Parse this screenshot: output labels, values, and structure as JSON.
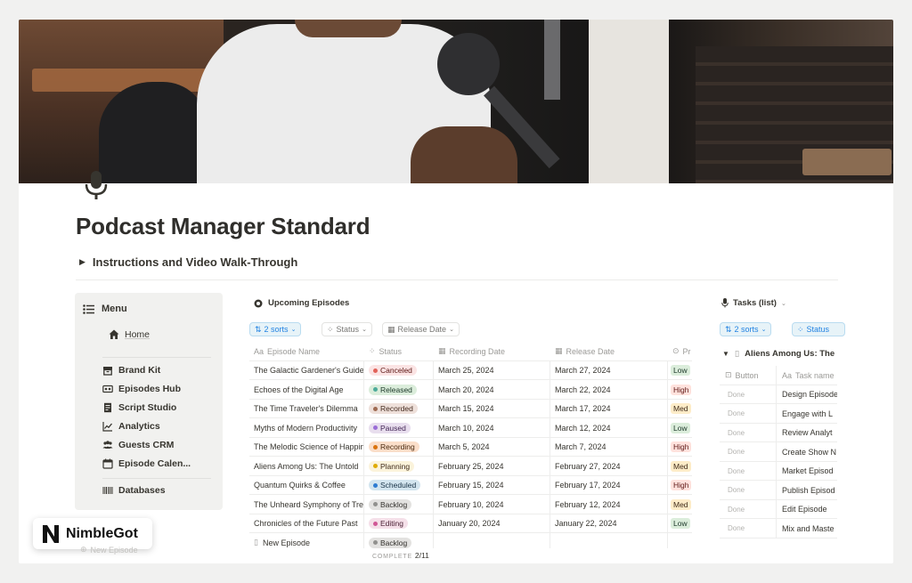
{
  "page": {
    "title": "Podcast Manager Standard",
    "toggle_label": "Instructions and Video Walk-Through"
  },
  "menu": {
    "title": "Menu",
    "home": "Home",
    "items": [
      {
        "label": "Brand Kit",
        "icon": "box-icon"
      },
      {
        "label": "Episodes Hub",
        "icon": "episodes-icon"
      },
      {
        "label": "Script Studio",
        "icon": "document-icon"
      },
      {
        "label": "Analytics",
        "icon": "chart-icon"
      },
      {
        "label": "Guests CRM",
        "icon": "people-icon"
      },
      {
        "label": "Episode Calen...",
        "icon": "calendar-icon"
      }
    ],
    "databases": "Databases"
  },
  "episodes": {
    "title": "Upcoming Episodes",
    "sorts_label": "2 sorts",
    "status_filter": "Status",
    "release_filter": "Release Date",
    "columns": [
      "Episode Name",
      "Status",
      "Recording Date",
      "Release Date",
      "Pr"
    ],
    "rows": [
      {
        "name": "The Galactic Gardener's Guide",
        "status": "Canceled",
        "recording": "March 25, 2024",
        "release": "March 27, 2024",
        "priority": "Low"
      },
      {
        "name": "Echoes of the Digital Age",
        "status": "Released",
        "recording": "March 20, 2024",
        "release": "March 22, 2024",
        "priority": "High"
      },
      {
        "name": "The Time Traveler's Dilemma",
        "status": "Recorded",
        "recording": "March 15, 2024",
        "release": "March 17, 2024",
        "priority": "Med"
      },
      {
        "name": "Myths of Modern Productivity",
        "status": "Paused",
        "recording": "March 10, 2024",
        "release": "March 12, 2024",
        "priority": "Low"
      },
      {
        "name": "The Melodic Science of Happiness",
        "status": "Recording",
        "recording": "March 5, 2024",
        "release": "March 7, 2024",
        "priority": "High"
      },
      {
        "name": "Aliens Among Us: The Untold",
        "status": "Planning",
        "recording": "February 25, 2024",
        "release": "February 27, 2024",
        "priority": "Med"
      },
      {
        "name": "Quantum Quirks & Coffee",
        "status": "Scheduled",
        "recording": "February 15, 2024",
        "release": "February 17, 2024",
        "priority": "High"
      },
      {
        "name": "The Unheard Symphony of Trees",
        "status": "Backlog",
        "recording": "February 10, 2024",
        "release": "February 12, 2024",
        "priority": "Med"
      },
      {
        "name": "Chronicles of the Future Past",
        "status": "Editing",
        "recording": "January 20, 2024",
        "release": "January 22, 2024",
        "priority": "Low"
      },
      {
        "name": "New Episode",
        "status": "Backlog",
        "recording": "",
        "release": "",
        "priority": ""
      }
    ],
    "complete_label": "COMPLETE",
    "complete_value": "2/11"
  },
  "status_colors": {
    "Canceled": {
      "bg": "#fbe4e4",
      "dot": "#e16259",
      "fg": "#5d1715"
    },
    "Released": {
      "bg": "#dbeddb",
      "dot": "#4dab9a",
      "fg": "#1c3829"
    },
    "Recorded": {
      "bg": "#eee0da",
      "dot": "#9f6b53",
      "fg": "#442a1e"
    },
    "Paused": {
      "bg": "#e8deee",
      "dot": "#9a6dd7",
      "fg": "#412454"
    },
    "Recording": {
      "bg": "#fadec9",
      "dot": "#d9730d",
      "fg": "#49290e"
    },
    "Planning": {
      "bg": "#fbf3db",
      "dot": "#dfab01",
      "fg": "#402c1b"
    },
    "Scheduled": {
      "bg": "#d3e5ef",
      "dot": "#2e7cd1",
      "fg": "#183347"
    },
    "Backlog": {
      "bg": "#e3e2e0",
      "dot": "#91918e",
      "fg": "#32302c"
    },
    "Editing": {
      "bg": "#f5e0e9",
      "dot": "#d15796",
      "fg": "#4c2337"
    }
  },
  "priority_colors": {
    "Low": {
      "bg": "#dbeddb",
      "fg": "#1c3829"
    },
    "High": {
      "bg": "#ffe2dd",
      "fg": "#5d1715"
    },
    "Med": {
      "bg": "#fdecc8",
      "fg": "#402c1b"
    }
  },
  "tasks": {
    "title": "Tasks (list)",
    "sorts_label": "2 sorts",
    "status_filter": "Status",
    "group_label": "Aliens Among Us: The",
    "columns": [
      "Button",
      "Task name"
    ],
    "rows": [
      {
        "button": "Done",
        "task": "Design Episode"
      },
      {
        "button": "Done",
        "task": "Engage with L"
      },
      {
        "button": "Done",
        "task": "Review Analyt"
      },
      {
        "button": "Done",
        "task": "Create Show N"
      },
      {
        "button": "Done",
        "task": "Market Episod"
      },
      {
        "button": "Done",
        "task": "Publish Episod"
      },
      {
        "button": "Done",
        "task": "Edit Episode"
      },
      {
        "button": "Done",
        "task": "Mix and Maste"
      }
    ]
  },
  "brand": {
    "name": "NimbleGot",
    "ghost_label": "New Episode"
  }
}
